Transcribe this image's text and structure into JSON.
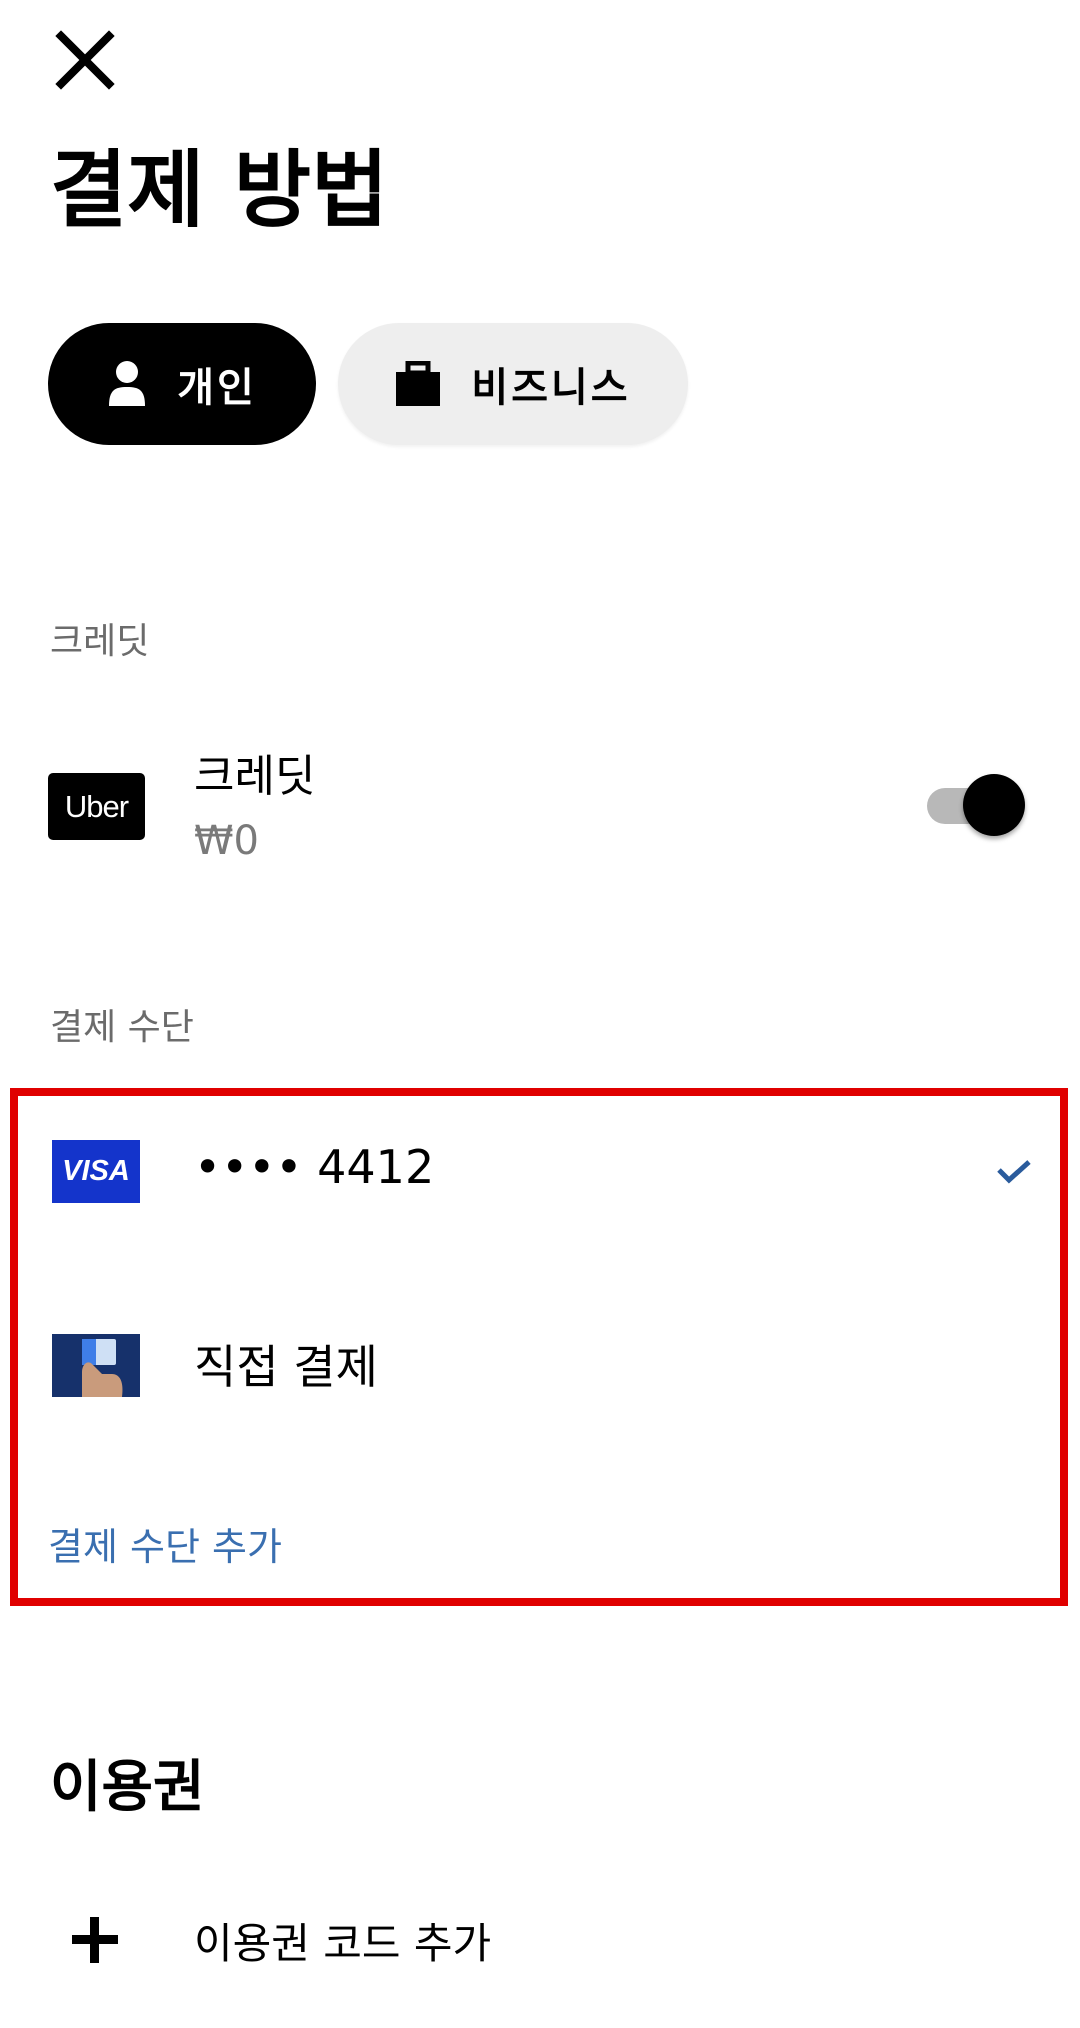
{
  "header": {
    "close_icon": "close-icon",
    "title": "결제 방법"
  },
  "profile_tabs": [
    {
      "label": "개인",
      "icon": "person-icon",
      "selected": true
    },
    {
      "label": "비즈니스",
      "icon": "briefcase-icon",
      "selected": false
    }
  ],
  "credit_section": {
    "header": "크레딧",
    "logo_text": "Uber",
    "title": "크레딧",
    "amount": "₩0",
    "toggle_on": true
  },
  "payment_section": {
    "header": "결제 수단",
    "methods": [
      {
        "logo_text": "VISA",
        "label": "•••• 4412",
        "selected": true
      },
      {
        "label": "직접 결제",
        "icon": "cash-payment-icon",
        "selected": false
      }
    ],
    "add_label": "결제 수단 추가"
  },
  "voucher_section": {
    "title": "이용권",
    "add_label": "이용권 코드 추가",
    "add_icon": "plus-icon"
  },
  "colors": {
    "highlight": "#e00000",
    "visa_blue": "#1434cb",
    "link_blue": "#3a6fb0",
    "check_blue": "#2a5b9c"
  }
}
